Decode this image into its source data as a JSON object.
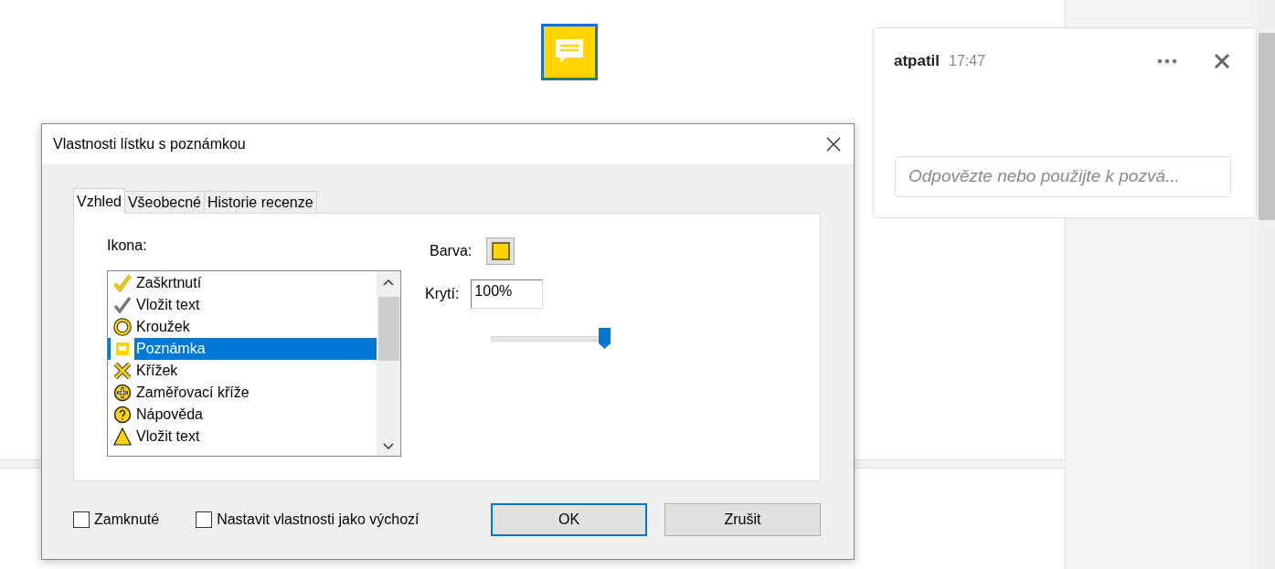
{
  "comment": {
    "author": "atpatil",
    "time": "17:47",
    "reply_placeholder": "Odpovězte nebo použijte k pozvá..."
  },
  "dialog": {
    "title": "Vlastnosti lístku s poznámkou",
    "tabs": [
      {
        "label": "Vzhled",
        "selected": true
      },
      {
        "label": "Všeobecné",
        "selected": false
      },
      {
        "label": "Historie recenze",
        "selected": false
      }
    ],
    "icon_label": "Ikona:",
    "icons": [
      {
        "kind": "check",
        "label": "Zaškrtnutí",
        "selected": false
      },
      {
        "kind": "graycheck",
        "label": "Vložit text",
        "selected": false
      },
      {
        "kind": "circle",
        "label": "Kroužek",
        "selected": false
      },
      {
        "kind": "note",
        "label": "Poznámka",
        "selected": true
      },
      {
        "kind": "cross",
        "label": "Křížek",
        "selected": false
      },
      {
        "kind": "crosshair",
        "label": "Zaměřovací kříže",
        "selected": false
      },
      {
        "kind": "help",
        "label": "Nápověda",
        "selected": false
      },
      {
        "kind": "triangle",
        "label": "Vložit text",
        "selected": false
      }
    ],
    "color_label": "Barva:",
    "color": "#ffd400",
    "opacity_label": "Krytí:",
    "opacity_value": "100%",
    "opacity_slider": {
      "level": 1.0
    },
    "checkboxes": [
      {
        "label": "Zamknuté",
        "checked": false
      },
      {
        "label": "Nastavit vlastnosti jako výchozí",
        "checked": false
      }
    ],
    "buttons": [
      {
        "label": "OK",
        "default": true
      },
      {
        "label": "Zrušit",
        "default": false
      }
    ]
  }
}
